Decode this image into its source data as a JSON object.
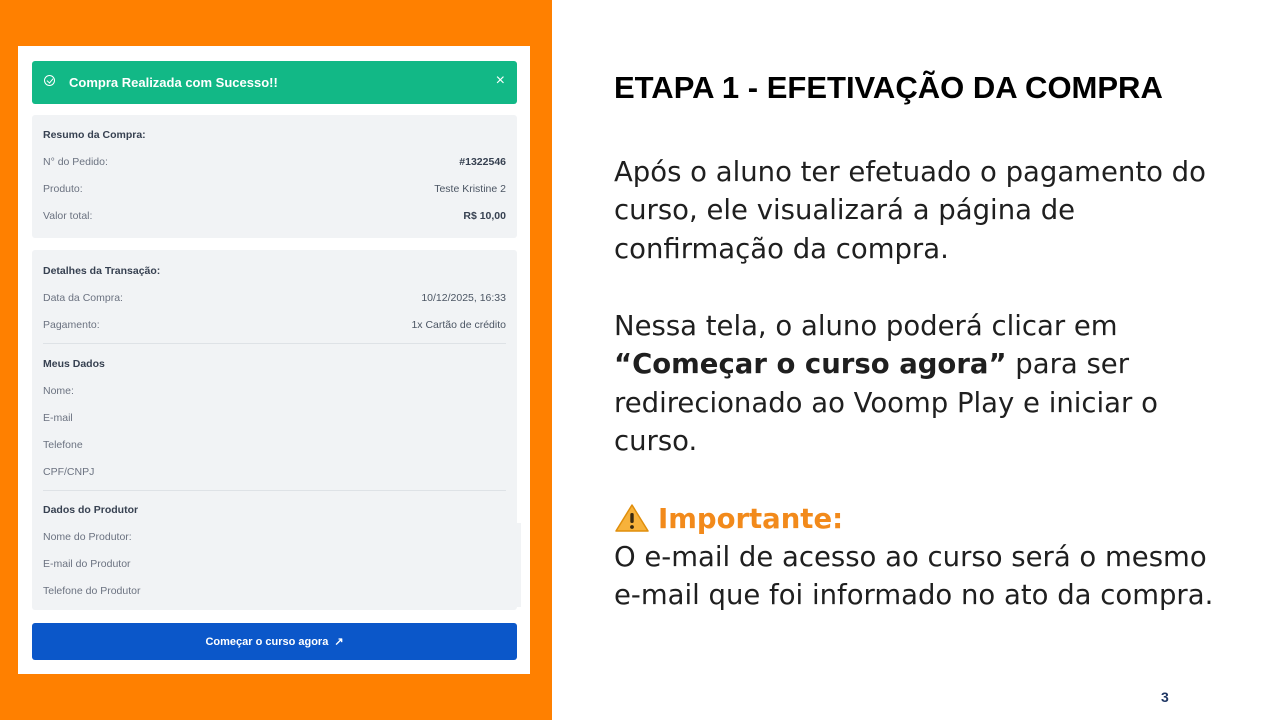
{
  "colors": {
    "left_panel": "#ff8000",
    "success": "#12b886",
    "button": "#0b57c9",
    "important": "#f28a1b",
    "page_number": "#203864"
  },
  "screenshot": {
    "alert": {
      "message": "Compra Realizada com Sucesso!!",
      "close_icon": "×"
    },
    "summary": {
      "heading": "Resumo da Compra:",
      "rows": [
        {
          "label": "N° do Pedido:",
          "value": "#1322546"
        },
        {
          "label": "Produto:",
          "value": "Teste Kristine 2"
        },
        {
          "label": "Valor total:",
          "value": "R$ 10,00"
        }
      ]
    },
    "transaction": {
      "heading": "Detalhes da Transação:",
      "rows": [
        {
          "label": "Data da Compra:",
          "value": "10/12/2025, 16:33"
        },
        {
          "label": "Pagamento:",
          "value": "1x Cartão de crédito"
        }
      ]
    },
    "my_data": {
      "heading": "Meus Dados",
      "rows": [
        {
          "label": "Nome:"
        },
        {
          "label": "E-mail"
        },
        {
          "label": "Telefone"
        },
        {
          "label": "CPF/CNPJ"
        }
      ]
    },
    "producer": {
      "heading": "Dados do Produtor",
      "rows": [
        {
          "label": "Nome do Produtor:"
        },
        {
          "label": "E-mail do Produtor"
        },
        {
          "label": "Telefone do Produtor"
        }
      ]
    },
    "start_button": {
      "label": "Começar o curso agora",
      "icon": "↗"
    }
  },
  "slide": {
    "title": "ETAPA 1 - EFETIVAÇÃO DA COMPRA",
    "p1": [
      "Após o aluno ter efetuado o pagamento do",
      "curso, ele visualizará a página de",
      "confirmação da compra."
    ],
    "p2": {
      "line1": "Nessa tela, o aluno poderá clicar em",
      "bold": "“Começar o curso agora”",
      "line2_rest": " para ser",
      "line3": "redirecionado ao Voomp Play e iniciar o",
      "line4": "curso."
    },
    "important": {
      "icon": "warning-icon",
      "label": "Importante:"
    },
    "p3": [
      "O e-mail de acesso ao curso será o mesmo",
      "e-mail que foi informado no ato da compra."
    ],
    "page_number": "3"
  }
}
